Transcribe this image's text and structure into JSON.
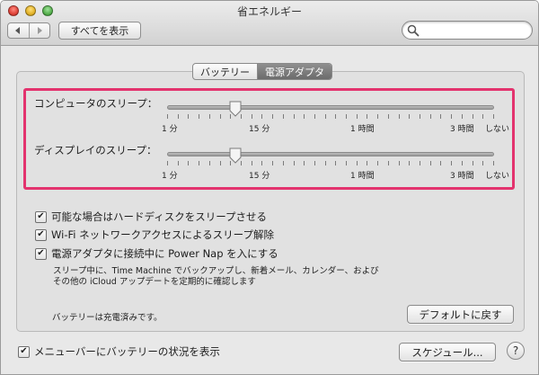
{
  "window": {
    "title": "省エネルギー"
  },
  "toolbar": {
    "back_icon": "back-arrow-icon",
    "forward_icon": "forward-arrow-icon",
    "show_all_label": "すべてを表示",
    "search_placeholder": "",
    "search_icon": "search-icon"
  },
  "tabs": [
    {
      "label": "バッテリー",
      "selected": false
    },
    {
      "label": "電源アダプタ",
      "selected": true
    }
  ],
  "sliders": [
    {
      "label": "コンピュータのスリープ：",
      "value_label": "15 分",
      "value_fraction": 0.21,
      "ticks": [
        "1 分",
        "15 分",
        "1 時間",
        "3 時間",
        "しない"
      ]
    },
    {
      "label": "ディスプレイのスリープ：",
      "value_label": "15 分",
      "value_fraction": 0.21,
      "ticks": [
        "1 分",
        "15 分",
        "1 時間",
        "3 時間",
        "しない"
      ]
    }
  ],
  "options": [
    {
      "label": "可能な場合はハードディスクをスリープさせる",
      "checked": true
    },
    {
      "label": "Wi-Fi ネットワークアクセスによるスリープ解除",
      "checked": true
    },
    {
      "label": "電源アダプタに接続中に Power Nap を入にする",
      "checked": true
    }
  ],
  "power_nap_note": [
    "スリープ中に、Time Machine でバックアップし、新着メール、カレンダー、および",
    "その他の iCloud アップデートを定期的に確認します"
  ],
  "status": "バッテリーは充電済みです。",
  "restore_defaults_label": "デフォルトに戻す",
  "menu_bar_option": {
    "label": "メニューバーにバッテリーの状況を表示",
    "checked": true
  },
  "schedule_label": "スケジュール...",
  "help_label": "?",
  "accent_color": "#e3336e"
}
